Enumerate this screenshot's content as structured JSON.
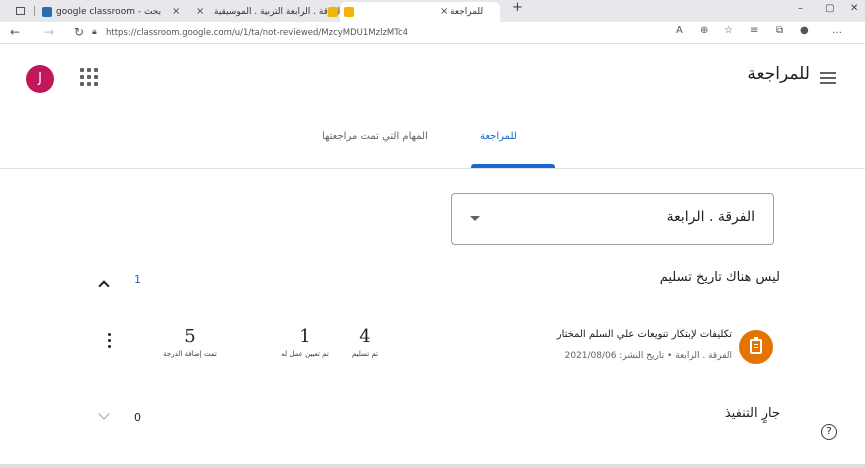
{
  "browser": {
    "tabs": [
      {
        "title": "google classroom - بحث"
      },
      {
        "title": "الفرقة . الرابعة التربية . الموسيقية"
      },
      {
        "title": "للمراجعة"
      }
    ],
    "new_tab": "+",
    "close": "×",
    "window": {
      "min": "–",
      "max": "▢",
      "close": "✕"
    },
    "url": "https://classroom.google.com/u/1/ta/not-reviewed/MzcyMDU1MzlzMTc4"
  },
  "header": {
    "avatar_letter": "J",
    "page_title": "للمراجعة"
  },
  "tabs": {
    "review": "للمراجعة",
    "reviewed": "المهام التي تمت مراجعتها"
  },
  "class_select": {
    "value": "الفرقة . الرابعة"
  },
  "sections": [
    {
      "title": "ليس هناك تاريخ تسليم",
      "count": "1"
    },
    {
      "title": "جارٍ التنفيذ",
      "count": "0"
    }
  ],
  "assignment": {
    "title": "تكليفات لإبتكار تنويعات علي السلم المختار",
    "subtitle": "الفرقة . الرابعة • تاريخ النشر: 2021/08/06",
    "stats": [
      {
        "num": "4",
        "label": "تم تسليم"
      },
      {
        "num": "1",
        "label": "تم تعيين عمل له"
      },
      {
        "num": "5",
        "label": "تمت إضافة الدرجة"
      }
    ]
  },
  "help": "?",
  "colors": {
    "accent": "#1967d2",
    "avatar": "#c2185b",
    "assignment_icon": "#e37400"
  }
}
